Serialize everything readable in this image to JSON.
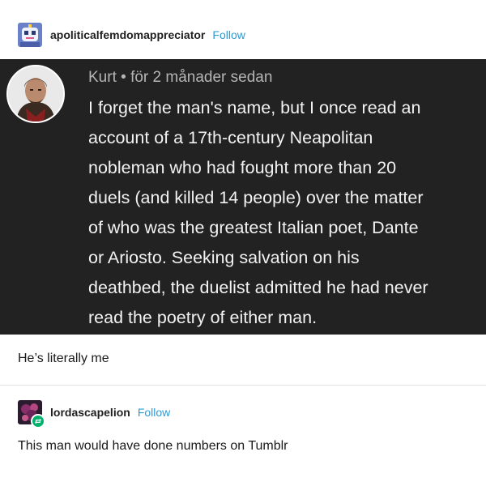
{
  "posts": [
    {
      "username": "apoliticalfemdomappreciator",
      "follow_label": "Follow",
      "avatar_icon": "robot-avatar-icon"
    },
    {
      "username": "lordascapelion",
      "follow_label": "Follow",
      "avatar_icon": "flower-avatar-icon",
      "reblog_badge_icon": "reblog-icon",
      "text": "This man would have done numbers on Tumblr"
    }
  ],
  "screenshot_comment": {
    "author": "Kurt",
    "separator": "•",
    "time": "för 2 månader sedan",
    "avatar_icon": "man-portrait-avatar-icon",
    "lines": [
      "I forget the man's name, but I once read an",
      "account of a 17th-century Neapolitan",
      "nobleman who had fought more than 20",
      "duels (and killed 14 people) over the matter",
      "of who was the greatest Italian poet, Dante",
      "or Ariosto.  Seeking salvation on his",
      "deathbed, the duelist admitted he had never",
      "read the poetry of either man."
    ]
  },
  "reblog_comment": {
    "text": "He’s literally me"
  },
  "colors": {
    "follow": "#2d9bd6",
    "screenshot_bg": "#222222",
    "reblog_badge": "#00b26b"
  }
}
